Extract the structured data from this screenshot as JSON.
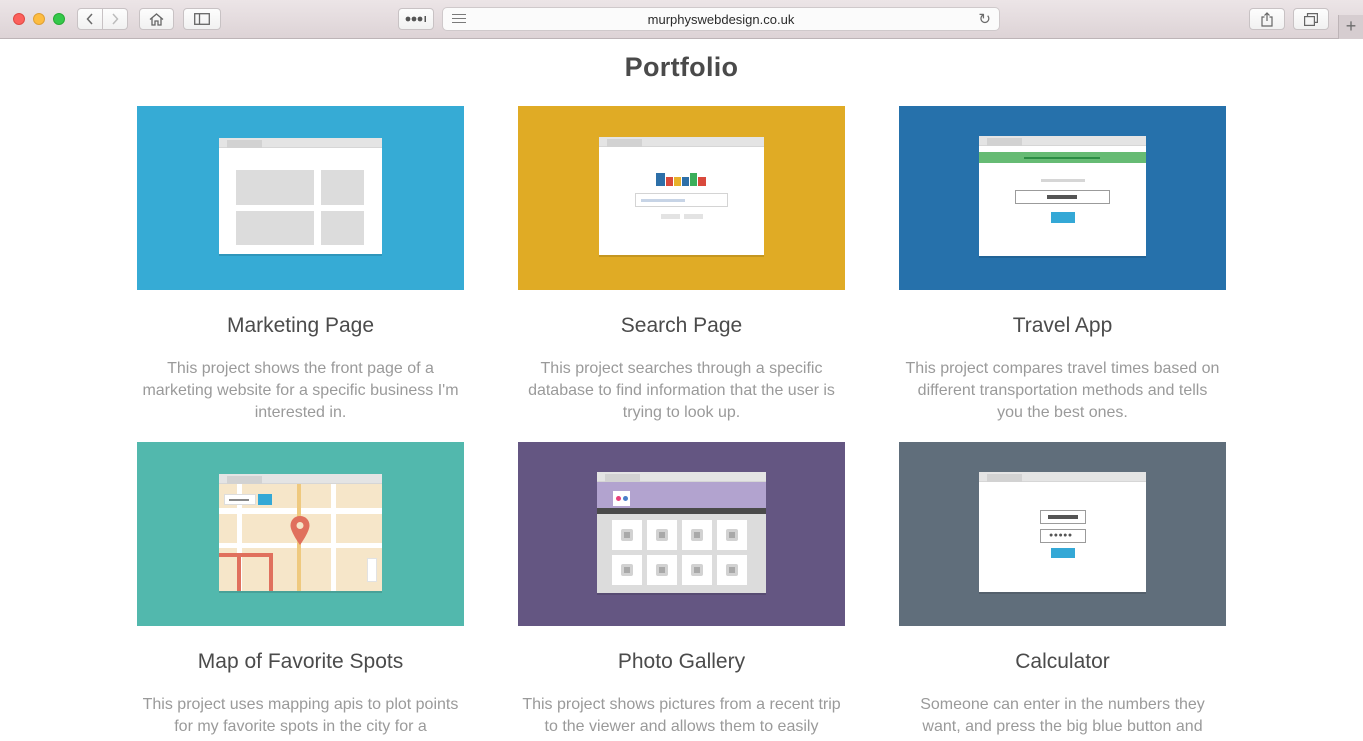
{
  "browser": {
    "url": "murphyswebdesign.co.uk",
    "icons": [
      "back-icon",
      "forward-icon",
      "home-icon",
      "sidebar-icon",
      "more-icon",
      "reader-icon",
      "reload-icon",
      "share-icon",
      "tabs-icon",
      "new-tab-icon"
    ]
  },
  "page": {
    "title": "Portfolio"
  },
  "projects": [
    {
      "title": "Marketing Page",
      "description": "This project shows the front page of a marketing website for a specific business I'm interested in.",
      "color": "#36abd5"
    },
    {
      "title": "Search Page",
      "description": "This project searches through a specific database to find information that the user is trying to look up.",
      "color": "#e0ab25"
    },
    {
      "title": "Travel App",
      "description": "This project compares travel times based on different transportation methods and tells you the best ones.",
      "color": "#2671ab"
    },
    {
      "title": "Map of Favorite Spots",
      "description": "This project uses mapping apis to plot points for my favorite spots in the city for a",
      "color": "#52b8ad"
    },
    {
      "title": "Photo Gallery",
      "description": "This project shows pictures from a recent trip to the viewer and allows them to easily",
      "color": "#645682"
    },
    {
      "title": "Calculator",
      "description": "Someone can enter in the numbers they want, and press the big blue button and",
      "color": "#606e7b"
    }
  ]
}
